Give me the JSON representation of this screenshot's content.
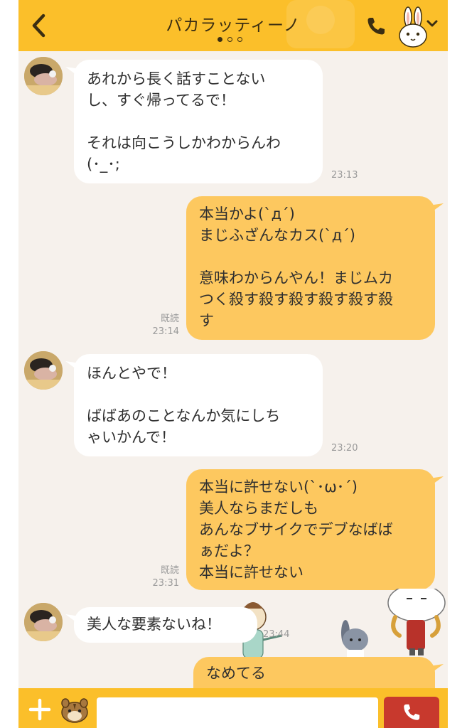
{
  "header": {
    "title": "パカラッティーノ",
    "back_icon": "chevron-left-icon",
    "call_icon": "phone-icon",
    "profile_icon": "rabbit-avatar-icon",
    "dropdown_icon": "chevron-down-icon",
    "page_indicator": {
      "count": 3,
      "active": 1
    }
  },
  "messages": [
    {
      "side": "left",
      "text": "あれから長く話すことない\nし、すぐ帰ってるで！\n\nそれは向こうしかわからんわ\n(･_･;",
      "time": "23:13"
    },
    {
      "side": "right",
      "text": "本当かよ(`д´)\nまじふざんなカス(`д´)\n\n意味わからんやん！まじムカ\nつく殺す殺す殺す殺す殺す殺\nす",
      "read": "既読",
      "time": "23:14"
    },
    {
      "side": "left",
      "text": "ほんとやで！\n\nばばあのことなんか気にしち\nゃいかんで！",
      "time": "23:20"
    },
    {
      "side": "right",
      "text": "本当に許せない(`･ω･´)\n美人ならまだしも\nあんなブサイクでデブなばば\nぁだよ？\n本当に許せない",
      "read": "既読",
      "time": "23:31"
    },
    {
      "side": "left",
      "text": "美人な要素ないね！",
      "time": "23:44"
    },
    {
      "side": "right",
      "text": "なめてる"
    }
  ],
  "input_bar": {
    "plus_icon": "plus-icon",
    "sticker_icon": "chipmunk-sticker-icon",
    "input_value": "",
    "call_icon": "phone-icon"
  },
  "colors": {
    "header": "#fbbf2a",
    "background": "#f6f1ec",
    "right_bubble": "#fdc85f",
    "left_bubble": "#ffffff",
    "call_button": "#c8392d"
  }
}
